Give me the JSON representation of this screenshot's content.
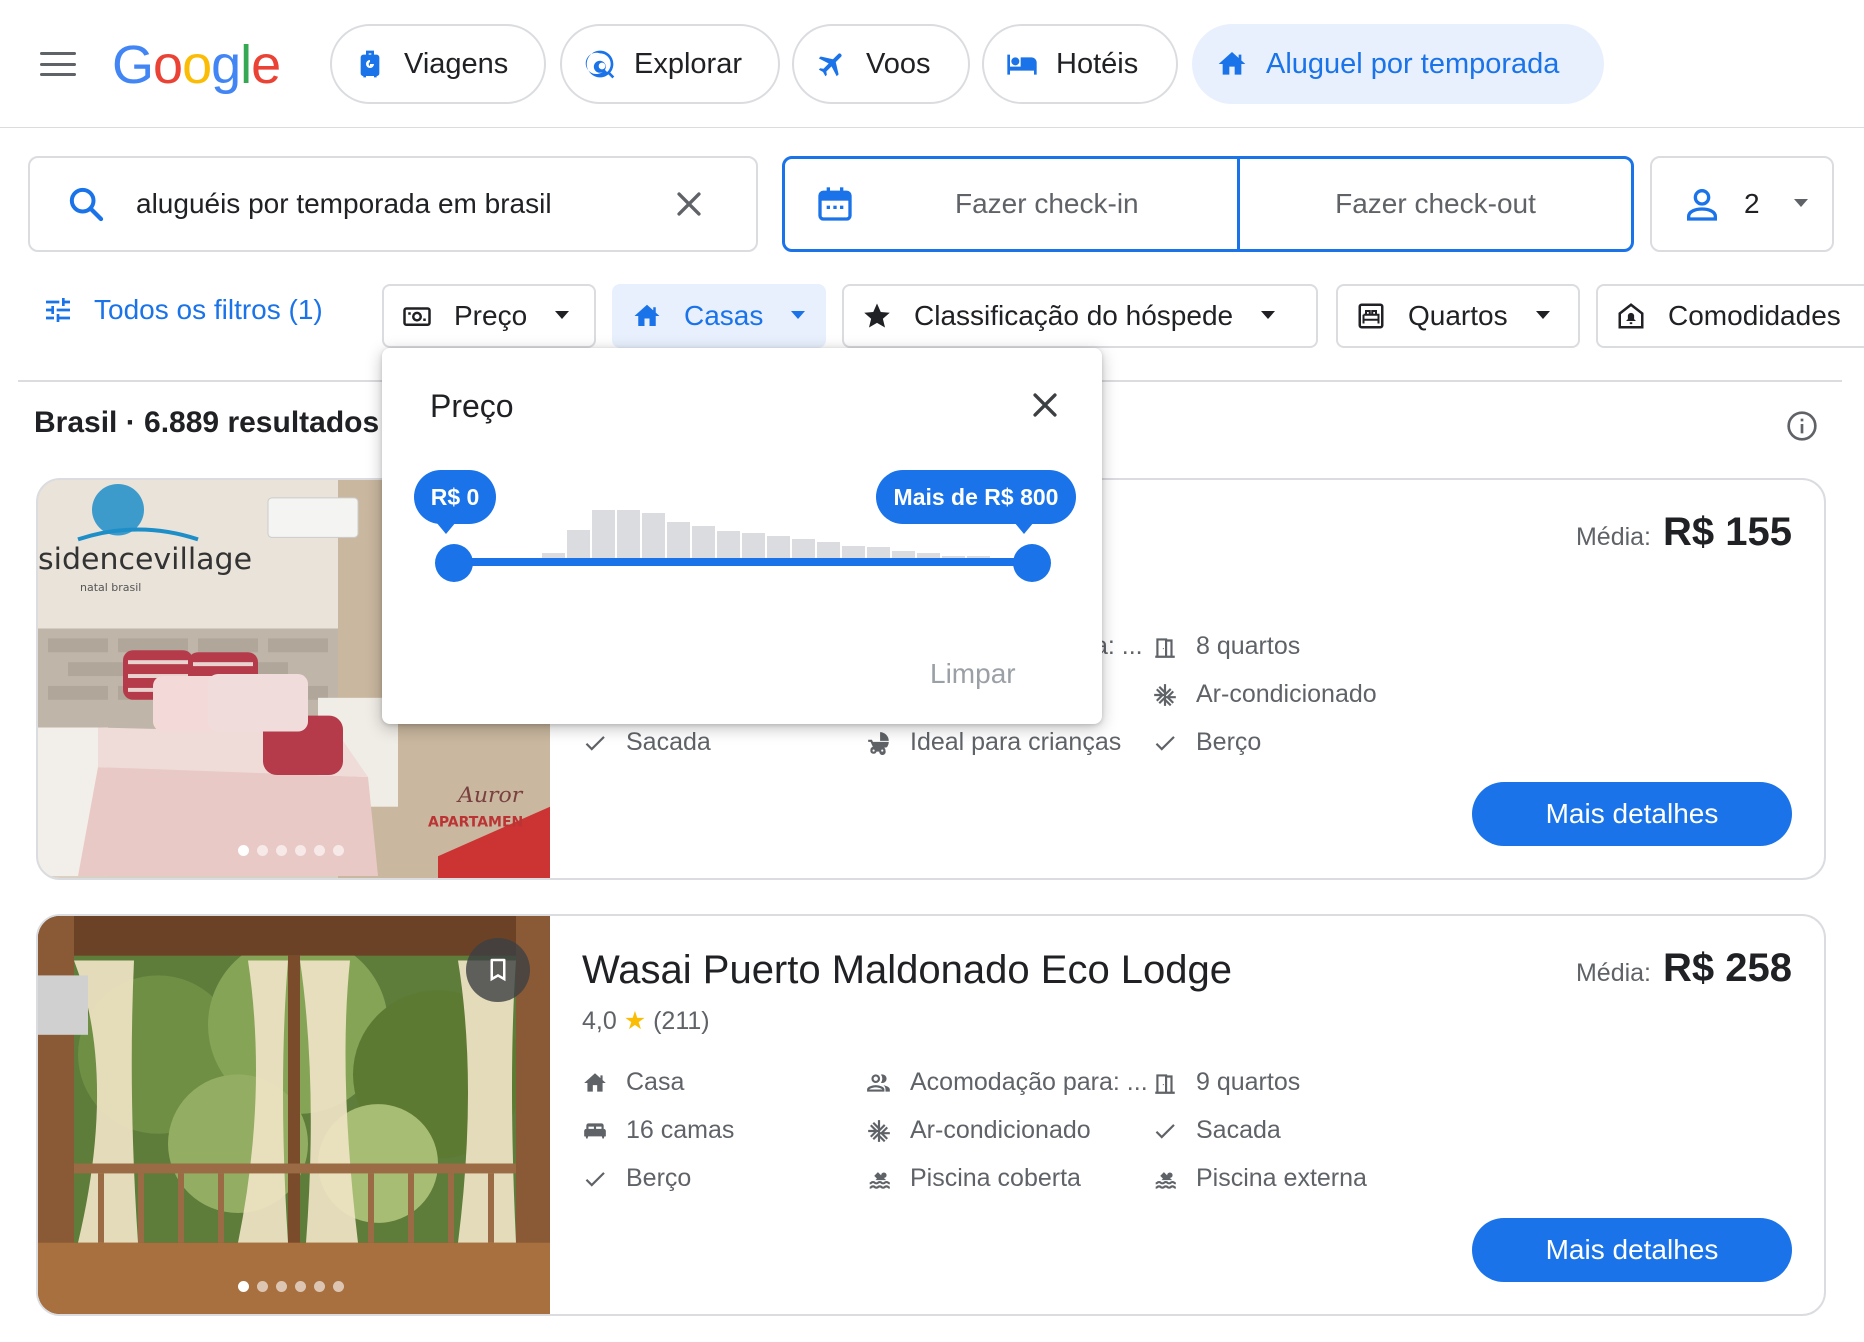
{
  "header": {
    "nav": [
      {
        "label": "Viagens",
        "icon": "luggage-icon",
        "active": false
      },
      {
        "label": "Explorar",
        "icon": "explore-icon",
        "active": false
      },
      {
        "label": "Voos",
        "icon": "plane-icon",
        "active": false
      },
      {
        "label": "Hotéis",
        "icon": "hotel-bed-icon",
        "active": false
      },
      {
        "label": "Aluguel por temporada",
        "icon": "home-icon",
        "active": true
      }
    ]
  },
  "search": {
    "query": "aluguéis por temporada em brasil"
  },
  "dates": {
    "checkin": "Fazer check-in",
    "checkout": "Fazer check-out"
  },
  "guests": {
    "count": "2"
  },
  "filters": {
    "all": "Todos os filtros (1)",
    "chips": [
      {
        "label": "Preço",
        "icon": "price-icon",
        "active": false
      },
      {
        "label": "Casas",
        "icon": "home-icon",
        "active": true
      },
      {
        "label": "Classificação do hóspede",
        "icon": "star-icon",
        "active": false
      },
      {
        "label": "Quartos",
        "icon": "bed-icon",
        "active": false
      },
      {
        "label": "Comodidades",
        "icon": "amenities-icon",
        "active": false
      }
    ]
  },
  "results": {
    "summary": "Brasil · 6.889 resultados"
  },
  "price_popup": {
    "title": "Preço",
    "min_label": "R$ 0",
    "max_label": "Mais de R$ 800",
    "clear": "Limpar",
    "histogram": [
      0.08,
      0.45,
      0.78,
      0.78,
      0.72,
      0.58,
      0.52,
      0.44,
      0.4,
      0.35,
      0.3,
      0.26,
      0.2,
      0.18,
      0.12,
      0.08,
      0.04,
      0.03
    ],
    "range_selected": [
      0,
      1
    ]
  },
  "listings": [
    {
      "title": "",
      "price_prefix": "Média:",
      "price": "R$ 155",
      "image_text": [
        "sidencevillage",
        "natal brasil",
        "Auror",
        "APARTAMEN"
      ],
      "amenities": [
        {
          "icon": "guests-icon",
          "text": "a: ..."
        },
        {
          "icon": "door-icon",
          "text": "8 quartos"
        },
        {
          "icon": "snowflake-icon",
          "text": "Ar-condicionado"
        },
        {
          "icon": "check-icon",
          "text": "Sacada"
        },
        {
          "icon": "stroller-icon",
          "text": "Ideal para crianças"
        },
        {
          "icon": "check-icon",
          "text": "Berço"
        }
      ],
      "button": "Mais detalhes"
    },
    {
      "title": "Wasai Puerto Maldonado Eco Lodge",
      "rating": "4,0",
      "reviews": "(211)",
      "price_prefix": "Média:",
      "price": "R$ 258",
      "amenities": [
        {
          "icon": "home-icon",
          "text": "Casa"
        },
        {
          "icon": "guests-icon",
          "text": "Acomodação para: ..."
        },
        {
          "icon": "door-icon",
          "text": "9 quartos"
        },
        {
          "icon": "bed-icon",
          "text": "16 camas"
        },
        {
          "icon": "snowflake-icon",
          "text": "Ar-condicionado"
        },
        {
          "icon": "check-icon",
          "text": "Sacada"
        },
        {
          "icon": "check-icon",
          "text": "Berço"
        },
        {
          "icon": "pool-icon",
          "text": "Piscina coberta"
        },
        {
          "icon": "pool-icon",
          "text": "Piscina externa"
        }
      ],
      "button": "Mais detalhes"
    }
  ],
  "colors": {
    "accent": "#1a73e8",
    "active_bg": "#e8f0fe",
    "border": "#dadce0",
    "star": "#fbbc04"
  }
}
